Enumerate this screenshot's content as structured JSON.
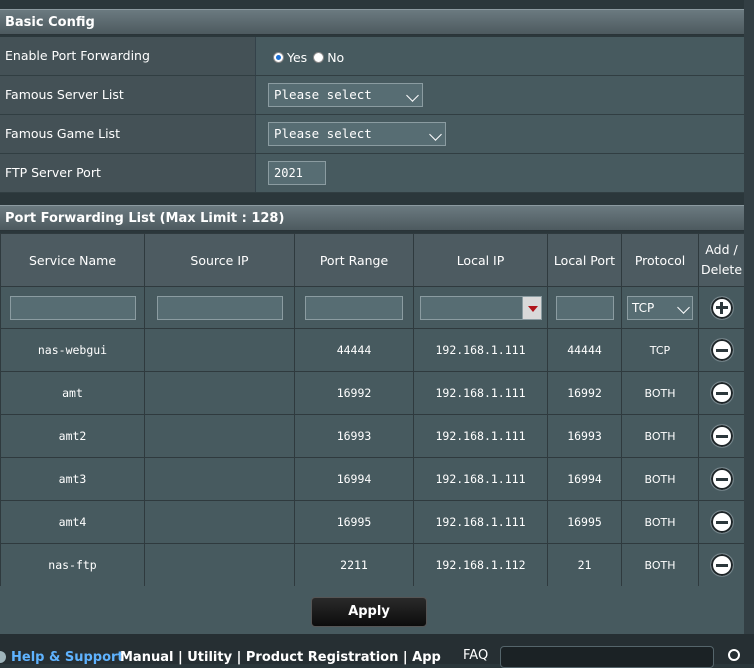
{
  "basic_config": {
    "header": "Basic Config",
    "rows": [
      {
        "label": "Enable Port Forwarding",
        "yes": "Yes",
        "no": "No"
      },
      {
        "label": "Famous Server List",
        "value": "Please select"
      },
      {
        "label": "Famous Game List",
        "value": "Please select"
      },
      {
        "label": "FTP Server Port",
        "value": "2021"
      }
    ]
  },
  "port_forwarding": {
    "header": "Port Forwarding List (Max Limit : 128)",
    "columns": [
      "Service Name",
      "Source IP",
      "Port Range",
      "Local IP",
      "Local Port",
      "Protocol",
      "Add / Delete"
    ],
    "new_protocol": "TCP",
    "rows": [
      {
        "service": "nas-webgui",
        "source_ip": "",
        "port_range": "44444",
        "local_ip": "192.168.1.111",
        "local_port": "44444",
        "protocol": "TCP"
      },
      {
        "service": "amt",
        "source_ip": "",
        "port_range": "16992",
        "local_ip": "192.168.1.111",
        "local_port": "16992",
        "protocol": "BOTH"
      },
      {
        "service": "amt2",
        "source_ip": "",
        "port_range": "16993",
        "local_ip": "192.168.1.111",
        "local_port": "16993",
        "protocol": "BOTH"
      },
      {
        "service": "amt3",
        "source_ip": "",
        "port_range": "16994",
        "local_ip": "192.168.1.111",
        "local_port": "16994",
        "protocol": "BOTH"
      },
      {
        "service": "amt4",
        "source_ip": "",
        "port_range": "16995",
        "local_ip": "192.168.1.111",
        "local_port": "16995",
        "protocol": "BOTH"
      },
      {
        "service": "nas-ftp",
        "source_ip": "",
        "port_range": "2211",
        "local_ip": "192.168.1.112",
        "local_port": "21",
        "protocol": "BOTH"
      }
    ]
  },
  "apply_label": "Apply",
  "footer": {
    "help": "Help & Support",
    "links": "Manual | Utility | Product Registration | App",
    "faq": "FAQ"
  },
  "colors": {
    "accent_link": "#5fb3ff",
    "panel": "#475a5f"
  }
}
